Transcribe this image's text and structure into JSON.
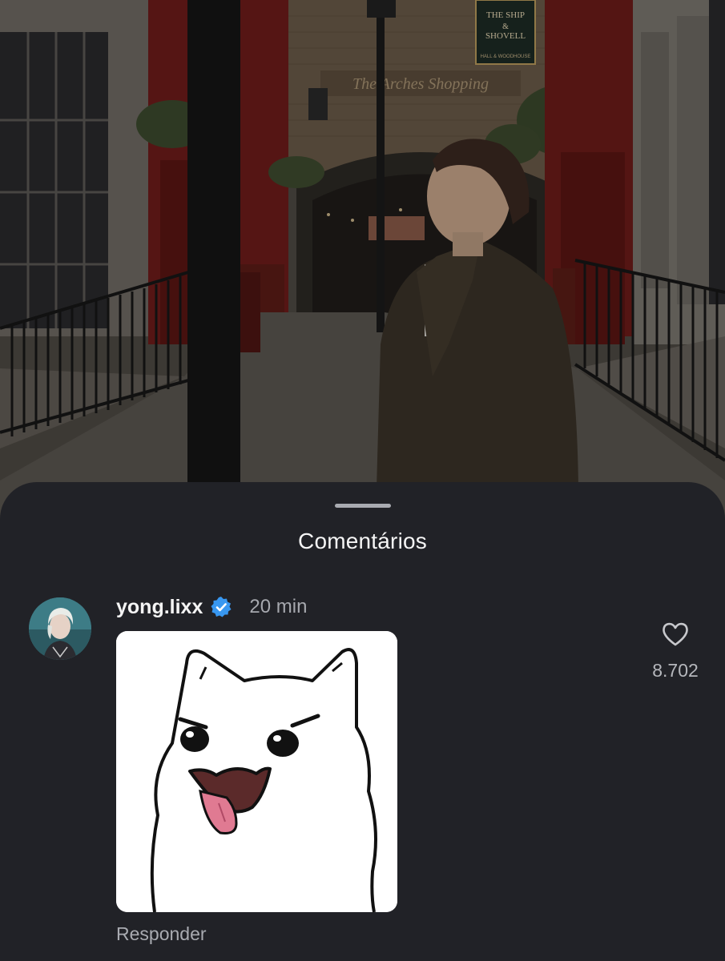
{
  "photo": {
    "sign_text": [
      "THE SHIP",
      "&",
      "SHOVELL"
    ],
    "sign_subtext": "HALL & WOODHOUSE",
    "arch_text": "The Arches Shopping"
  },
  "sheet": {
    "title": "Comentários"
  },
  "comment": {
    "username": "yong.lixx",
    "verified": true,
    "time": "20 min",
    "reply_label": "Responder",
    "like_icon": "heart-outline-icon",
    "like_count": "8.702"
  },
  "colors": {
    "sheet_bg": "#212227",
    "verified_blue": "#3897f0",
    "text_primary": "#f4f4f4",
    "text_secondary": "#a6a8ae"
  }
}
